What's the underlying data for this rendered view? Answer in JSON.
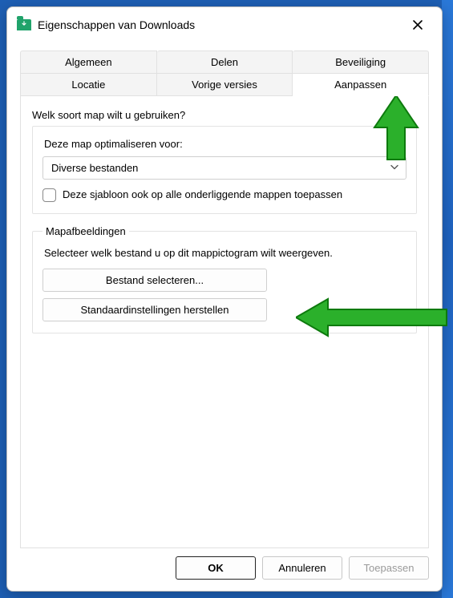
{
  "window": {
    "title": "Eigenschappen van Downloads"
  },
  "tabs": {
    "row1": [
      "Algemeen",
      "Delen",
      "Beveiliging"
    ],
    "row2": [
      "Locatie",
      "Vorige versies",
      "Aanpassen"
    ],
    "active": "Aanpassen"
  },
  "customize": {
    "heading": "Welk soort map wilt u gebruiken?",
    "optimize_label": "Deze map optimaliseren voor:",
    "optimize_value": "Diverse bestanden",
    "apply_sub_label": "Deze sjabloon ook op alle onderliggende mappen toepassen",
    "apply_sub_checked": false
  },
  "mapimages": {
    "legend": "Mapafbeeldingen",
    "desc": "Selecteer welk bestand u op dit mappictogram wilt weergeven.",
    "choose_file": "Bestand selecteren...",
    "restore_defaults": "Standaardinstellingen herstellen"
  },
  "footer": {
    "ok": "OK",
    "cancel": "Annuleren",
    "apply": "Toepassen"
  }
}
